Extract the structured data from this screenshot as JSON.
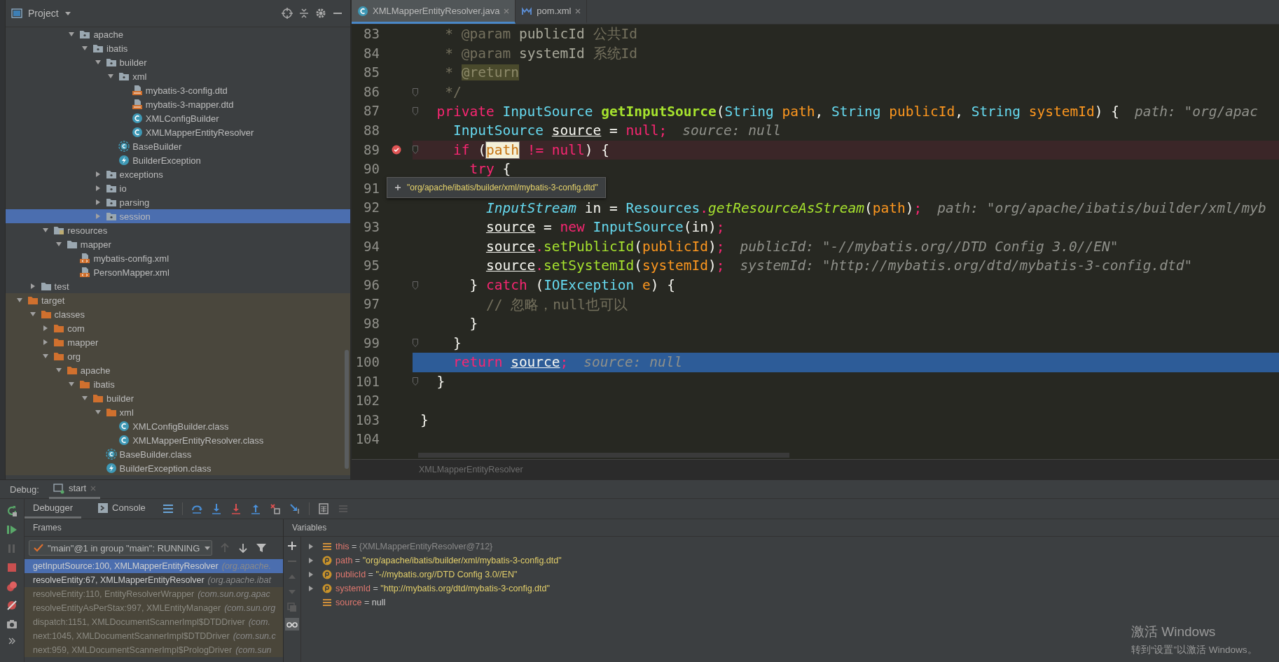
{
  "project_panel": {
    "title": "Project",
    "tree": [
      {
        "children": [
          {
            "children": [
              {
                "children": [
                  {
                    "children": [
                      {
                        "label": "apache",
                        "kind": "package",
                        "expanded": true,
                        "selected": false,
                        "children": [
                          {
                            "label": "ibatis",
                            "kind": "package",
                            "expanded": true,
                            "selected": false,
                            "children": [
                              {
                                "label": "builder",
                                "kind": "package",
                                "expanded": true,
                                "selected": false,
                                "children": [
                                  {
                                    "label": "xml",
                                    "kind": "package",
                                    "expanded": true,
                                    "selected": false,
                                    "children": [
                                      {
                                        "label": "mybatis-3-config.dtd",
                                        "kind": "dtd",
                                        "selected": false
                                      },
                                      {
                                        "label": "mybatis-3-mapper.dtd",
                                        "kind": "dtd",
                                        "selected": false
                                      },
                                      {
                                        "label": "XMLConfigBuilder",
                                        "kind": "class",
                                        "selected": false
                                      },
                                      {
                                        "label": "XMLMapperEntityResolver",
                                        "kind": "class",
                                        "selected": false
                                      }
                                    ]
                                  },
                                  {
                                    "label": "BaseBuilder",
                                    "kind": "abstract",
                                    "selected": false
                                  },
                                  {
                                    "label": "BuilderException",
                                    "kind": "exception",
                                    "selected": false
                                  }
                                ]
                              },
                              {
                                "label": "exceptions",
                                "kind": "package",
                                "expanded": false,
                                "selected": false
                              },
                              {
                                "label": "io",
                                "kind": "package",
                                "expanded": false,
                                "selected": false
                              },
                              {
                                "label": "parsing",
                                "kind": "package",
                                "expanded": false,
                                "selected": false
                              },
                              {
                                "label": "session",
                                "kind": "package",
                                "expanded": false,
                                "selected": true
                              }
                            ]
                          }
                        ]
                      }
                    ]
                  }
                ]
              },
              {
                "label": "resources",
                "kind": "resources",
                "expanded": true,
                "selected": false,
                "children": [
                  {
                    "label": "mapper",
                    "kind": "folder",
                    "expanded": true,
                    "selected": false,
                    "children": [
                      {
                        "label": "mybatis-config.xml",
                        "kind": "xml",
                        "selected": false
                      },
                      {
                        "label": "PersonMapper.xml",
                        "kind": "xml",
                        "selected": false
                      }
                    ]
                  }
                ]
              }
            ]
          },
          {
            "label": "test",
            "kind": "folder",
            "expanded": false,
            "selected": false
          }
        ]
      },
      {
        "label": "target",
        "kind": "excluded",
        "expanded": true,
        "selected": false,
        "excluded": true,
        "children": [
          {
            "label": "classes",
            "kind": "excluded",
            "expanded": true,
            "selected": false,
            "children": [
              {
                "label": "com",
                "kind": "excluded",
                "expanded": false,
                "selected": false
              },
              {
                "label": "mapper",
                "kind": "excluded",
                "expanded": false,
                "selected": false
              },
              {
                "label": "org",
                "kind": "excluded",
                "expanded": true,
                "selected": false,
                "children": [
                  {
                    "label": "apache",
                    "kind": "excluded",
                    "expanded": true,
                    "selected": false,
                    "children": [
                      {
                        "label": "ibatis",
                        "kind": "excluded",
                        "expanded": true,
                        "selected": false,
                        "children": [
                          {
                            "label": "builder",
                            "kind": "excluded",
                            "expanded": true,
                            "selected": false,
                            "children": [
                              {
                                "label": "xml",
                                "kind": "excluded",
                                "expanded": true,
                                "selected": false,
                                "children": [
                                  {
                                    "label": "XMLConfigBuilder.class",
                                    "kind": "class",
                                    "selected": false
                                  },
                                  {
                                    "label": "XMLMapperEntityResolver.class",
                                    "kind": "class",
                                    "selected": false
                                  }
                                ]
                              },
                              {
                                "label": "BaseBuilder.class",
                                "kind": "abstract",
                                "selected": false
                              },
                              {
                                "label": "BuilderException.class",
                                "kind": "exception",
                                "selected": false
                              }
                            ]
                          }
                        ]
                      }
                    ]
                  }
                ]
              }
            ]
          }
        ]
      }
    ]
  },
  "editor": {
    "tabs": [
      {
        "label": "XMLMapperEntityResolver.java",
        "kind": "class",
        "selected": true
      },
      {
        "label": "pom.xml",
        "kind": "maven",
        "selected": false
      }
    ],
    "lines": [
      {
        "n": "83",
        "code": [
          {
            "kind": "doc",
            "text": "   * @param "
          },
          {
            "kind": "docid",
            "text": "publicId"
          },
          {
            "kind": "doc",
            "text": " 公共Id"
          }
        ]
      },
      {
        "n": "84",
        "code": [
          {
            "kind": "doc",
            "text": "   * @param "
          },
          {
            "kind": "docid",
            "text": "systemId"
          },
          {
            "kind": "doc",
            "text": " 系统Id"
          }
        ]
      },
      {
        "n": "85",
        "code": [
          {
            "kind": "doc",
            "text": "   * "
          },
          {
            "kind": "doctag",
            "text": "@return"
          }
        ]
      },
      {
        "n": "86",
        "fold": true,
        "code": [
          {
            "kind": "doc",
            "text": "   */"
          }
        ]
      },
      {
        "n": "87",
        "fold": true,
        "code": [
          {
            "kind": "kw",
            "text": "  private "
          },
          {
            "kind": "type",
            "text": "InputSource "
          },
          {
            "kind": "fn",
            "text": "getInputSource"
          },
          {
            "kind": "plain",
            "text": "("
          },
          {
            "kind": "type",
            "text": "String "
          },
          {
            "kind": "param",
            "text": "path"
          },
          {
            "kind": "plain",
            "text": ", "
          },
          {
            "kind": "type",
            "text": "String "
          },
          {
            "kind": "param",
            "text": "publicId"
          },
          {
            "kind": "plain",
            "text": ", "
          },
          {
            "kind": "type",
            "text": "String "
          },
          {
            "kind": "param",
            "text": "systemId"
          },
          {
            "kind": "plain",
            "text": ") {"
          }
        ],
        "hint": "path: \"org/apac"
      },
      {
        "n": "88",
        "code": [
          {
            "kind": "type",
            "text": "    InputSource "
          },
          {
            "kind": "var",
            "text": "source"
          },
          {
            "kind": "plain",
            "text": " = "
          },
          {
            "kind": "kw",
            "text": "null;"
          }
        ],
        "hint": "source: null"
      },
      {
        "n": "89",
        "fold": true,
        "breakpoint": true,
        "code": [
          {
            "kind": "kw",
            "text": "    if "
          },
          {
            "kind": "plain",
            "text": "("
          },
          {
            "kind": "caret",
            "text": "path"
          },
          {
            "kind": "kw",
            "text": " != null"
          },
          {
            "kind": "plain",
            "text": ") {"
          }
        ]
      },
      {
        "n": "90",
        "code": [
          {
            "kind": "kw",
            "text": "      try"
          },
          {
            "kind": "plain",
            "text": " {"
          }
        ]
      },
      {
        "n": "91",
        "tooltip": "\"org/apache/ibatis/builder/xml/mybatis-3-config.dtd\""
      },
      {
        "n": "92",
        "code": [
          {
            "kind": "typei",
            "text": "        InputStream "
          },
          {
            "kind": "plain",
            "text": "in = "
          },
          {
            "kind": "type",
            "text": "Resources"
          },
          {
            "kind": "kw",
            "text": "."
          },
          {
            "kind": "calli",
            "text": "getResourceAsStream"
          },
          {
            "kind": "plain",
            "text": "("
          },
          {
            "kind": "param",
            "text": "path"
          },
          {
            "kind": "plain",
            "text": ")"
          },
          {
            "kind": "kw",
            "text": ";"
          }
        ],
        "hint": "path: \"org/apache/ibatis/builder/xml/myb"
      },
      {
        "n": "93",
        "code": [
          {
            "kind": "var",
            "text": "        source"
          },
          {
            "kind": "plain",
            "text": " = "
          },
          {
            "kind": "kw",
            "text": "new "
          },
          {
            "kind": "type",
            "text": "InputSource"
          },
          {
            "kind": "plain",
            "text": "(in)"
          },
          {
            "kind": "kw",
            "text": ";"
          }
        ]
      },
      {
        "n": "94",
        "code": [
          {
            "kind": "var",
            "text": "        source"
          },
          {
            "kind": "kw",
            "text": "."
          },
          {
            "kind": "call",
            "text": "setPublicId"
          },
          {
            "kind": "plain",
            "text": "("
          },
          {
            "kind": "param",
            "text": "publicId"
          },
          {
            "kind": "plain",
            "text": ")"
          },
          {
            "kind": "kw",
            "text": ";"
          }
        ],
        "hint": "publicId: \"-//mybatis.org//DTD Config 3.0//EN\""
      },
      {
        "n": "95",
        "code": [
          {
            "kind": "var",
            "text": "        source"
          },
          {
            "kind": "kw",
            "text": "."
          },
          {
            "kind": "call",
            "text": "setSystemId"
          },
          {
            "kind": "plain",
            "text": "("
          },
          {
            "kind": "param",
            "text": "systemId"
          },
          {
            "kind": "plain",
            "text": ")"
          },
          {
            "kind": "kw",
            "text": ";"
          }
        ],
        "hint": "systemId: \"http://mybatis.org/dtd/mybatis-3-config.dtd\""
      },
      {
        "n": "96",
        "fold": true,
        "code": [
          {
            "kind": "plain",
            "text": "      } "
          },
          {
            "kind": "kw",
            "text": "catch "
          },
          {
            "kind": "plain",
            "text": "("
          },
          {
            "kind": "type",
            "text": "IOException "
          },
          {
            "kind": "param",
            "text": "e"
          },
          {
            "kind": "plain",
            "text": ") {"
          }
        ]
      },
      {
        "n": "97",
        "code": [
          {
            "kind": "comment",
            "text": "        // 忽略，null也可以"
          }
        ]
      },
      {
        "n": "98",
        "code": [
          {
            "kind": "plain",
            "text": "      }"
          }
        ]
      },
      {
        "n": "99",
        "fold": true,
        "code": [
          {
            "kind": "plain",
            "text": "    }"
          }
        ]
      },
      {
        "n": "100",
        "current": true,
        "code": [
          {
            "kind": "kw",
            "text": "    return "
          },
          {
            "kind": "var",
            "text": "source"
          },
          {
            "kind": "kw",
            "text": ";"
          }
        ],
        "hint": "source: null"
      },
      {
        "n": "101",
        "fold": true,
        "code": [
          {
            "kind": "plain",
            "text": "  }"
          }
        ]
      },
      {
        "n": "102"
      },
      {
        "n": "103",
        "code": [
          {
            "kind": "plain",
            "text": "}"
          }
        ]
      },
      {
        "n": "104"
      }
    ],
    "breadcrumb": "XMLMapperEntityResolver"
  },
  "debug": {
    "title": "Debug:",
    "session_tab": {
      "label": "start",
      "selected": true
    },
    "tabs": [
      {
        "label": "Debugger",
        "kind": "plain",
        "selected": true
      },
      {
        "label": "Console",
        "kind": "console",
        "selected": false
      }
    ],
    "frames": {
      "title": "Frames",
      "thread": "\"main\"@1 in group \"main\": RUNNING",
      "items": [
        {
          "method": "getInputSource:100, XMLMapperEntityResolver",
          "location": "(org.apache.",
          "selected": true,
          "library": false
        },
        {
          "method": "resolveEntity:67, XMLMapperEntityResolver",
          "location": "(org.apache.ibat",
          "selected": false,
          "library": false
        },
        {
          "method": "resolveEntity:110, EntityResolverWrapper",
          "location": "(com.sun.org.apac",
          "selected": false,
          "library": true
        },
        {
          "method": "resolveEntityAsPerStax:997, XMLEntityManager",
          "location": "(com.sun.org",
          "selected": false,
          "library": true
        },
        {
          "method": "dispatch:1151, XMLDocumentScannerImpl$DTDDriver",
          "location": "(com.",
          "selected": false,
          "library": true
        },
        {
          "method": "next:1045, XMLDocumentScannerImpl$DTDDriver",
          "location": "(com.sun.c",
          "selected": false,
          "library": true
        },
        {
          "method": "next:959, XMLDocumentScannerImpl$PrologDriver",
          "location": "(com.sun",
          "selected": false,
          "library": true
        }
      ]
    },
    "variables": {
      "title": "Variables",
      "items": [
        {
          "name": "this",
          "op": "=",
          "value": "{XMLMapperEntityResolver@712}",
          "kind": "object",
          "expandable": true
        },
        {
          "name": "path",
          "op": "=",
          "value": "\"org/apache/ibatis/builder/xml/mybatis-3-config.dtd\"",
          "kind": "string-param",
          "expandable": true
        },
        {
          "name": "publicId",
          "op": "=",
          "value": "\"-//mybatis.org//DTD Config 3.0//EN\"",
          "kind": "string-param",
          "expandable": true
        },
        {
          "name": "systemId",
          "op": "=",
          "value": "\"http://mybatis.org/dtd/mybatis-3-config.dtd\"",
          "kind": "string-param",
          "expandable": true
        },
        {
          "name": "source",
          "op": "=",
          "value": "null",
          "kind": "null",
          "expandable": false
        }
      ]
    }
  },
  "os_notice": {
    "title": "激活 Windows",
    "text": "转到“设置”以激活 Windows。"
  }
}
